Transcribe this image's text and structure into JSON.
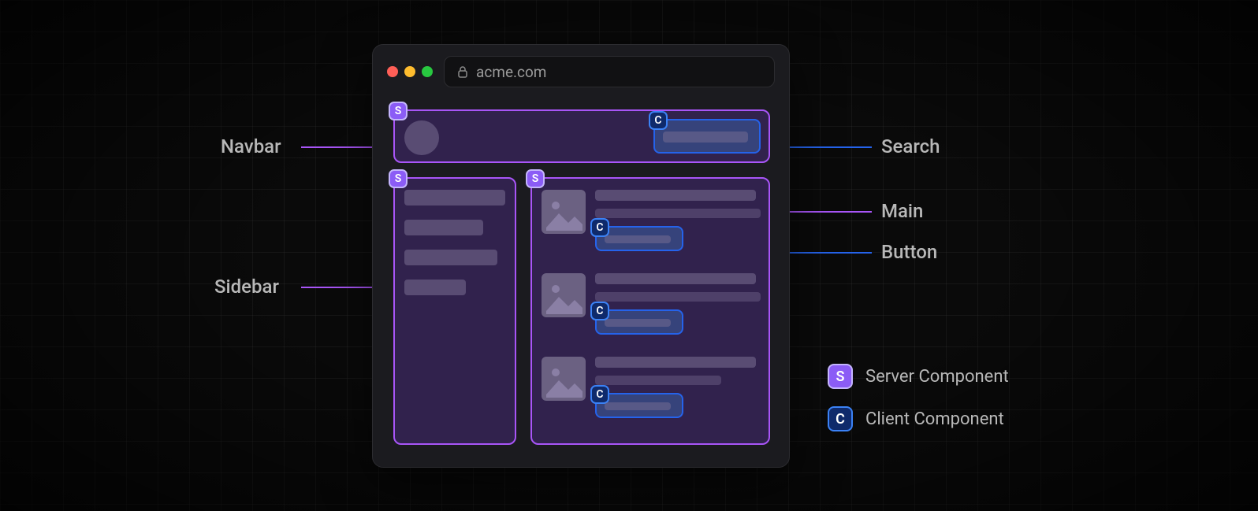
{
  "browser": {
    "url": "acme.com"
  },
  "annotations": {
    "navbar": "Navbar",
    "sidebar": "Sidebar",
    "search": "Search",
    "main": "Main",
    "button": "Button"
  },
  "legend": {
    "server": {
      "badge": "S",
      "label": "Server Component"
    },
    "client": {
      "badge": "C",
      "label": "Client Component"
    }
  },
  "badges": {
    "s": "S",
    "c": "C"
  },
  "colors": {
    "server_border": "#a855f7",
    "client_border": "#2563eb"
  }
}
